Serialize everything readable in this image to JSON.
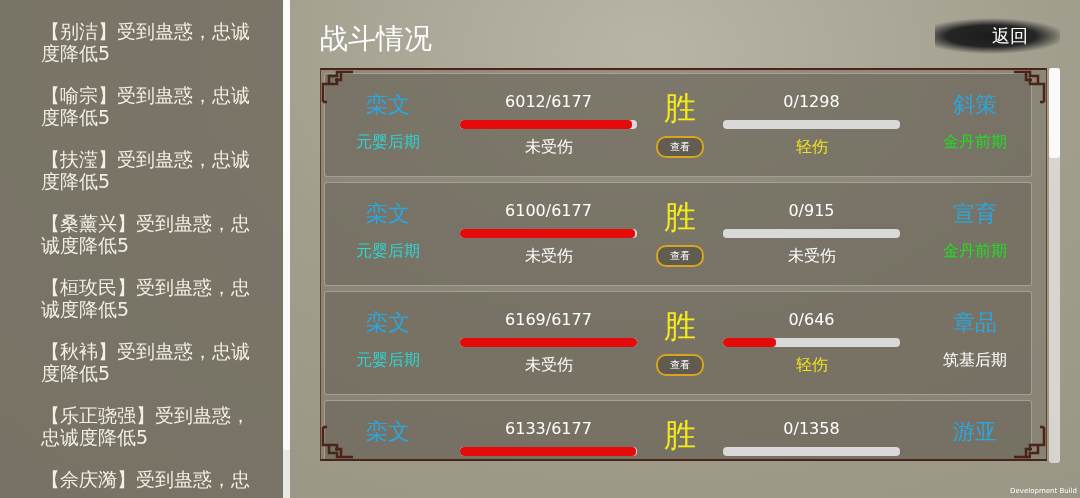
{
  "log": [
    "【别洁】受到蛊惑，忠诚度降低5",
    "【喻宗】受到蛊惑，忠诚度降低5",
    "【扶滢】受到蛊惑，忠诚度降低5",
    "【桑薰兴】受到蛊惑，忠诚度降低5",
    "【桓玫民】受到蛊惑，忠诚度降低5",
    "【秋袆】受到蛊惑，忠诚度降低5",
    "【乐正骁强】受到蛊惑，忠诚度降低5",
    "【佘庆漪】受到蛊惑，忠"
  ],
  "title": "战斗情况",
  "back_button": "返回",
  "battles": [
    {
      "left": {
        "name": "栾文",
        "hp": "6012/6177",
        "level": 0.973,
        "injury": {
          "text": "未受伤",
          "color": "#ffffff"
        },
        "realm": {
          "text": "元婴后期",
          "color": "#2fd3d3"
        }
      },
      "result": "胜",
      "view_button": "查看",
      "right": {
        "name": "斜策",
        "hp": "0/1298",
        "level": 0,
        "injury": {
          "text": "轻伤",
          "color": "#f2e21c"
        },
        "realm": {
          "text": "金丹前期",
          "color": "#22dd22"
        }
      }
    },
    {
      "left": {
        "name": "栾文",
        "hp": "6100/6177",
        "level": 0.988,
        "injury": {
          "text": "未受伤",
          "color": "#ffffff"
        },
        "realm": {
          "text": "元婴后期",
          "color": "#2fd3d3"
        }
      },
      "result": "胜",
      "view_button": "查看",
      "right": {
        "name": "宣育",
        "hp": "0/915",
        "level": 0,
        "injury": {
          "text": "未受伤",
          "color": "#ffffff"
        },
        "realm": {
          "text": "金丹前期",
          "color": "#22dd22"
        }
      }
    },
    {
      "left": {
        "name": "栾文",
        "hp": "6169/6177",
        "level": 0.999,
        "injury": {
          "text": "未受伤",
          "color": "#ffffff"
        },
        "realm": {
          "text": "元婴后期",
          "color": "#2fd3d3"
        }
      },
      "result": "胜",
      "view_button": "查看",
      "right": {
        "name": "章品",
        "hp": "0/646",
        "level": 0.3,
        "injury": {
          "text": "轻伤",
          "color": "#f2e21c"
        },
        "realm": {
          "text": "筑基后期",
          "color": "#ffffff"
        }
      }
    },
    {
      "left": {
        "name": "栾文",
        "hp": "6133/6177",
        "level": 0.993
      },
      "result": "胜",
      "right": {
        "name": "游亚",
        "hp": "0/1358",
        "level": 0
      }
    }
  ],
  "footer": "Development Build"
}
